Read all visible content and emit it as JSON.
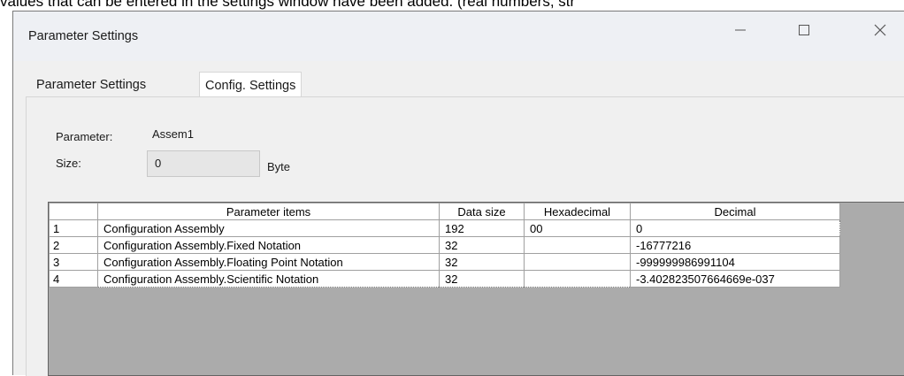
{
  "caption": "values that can be entered in the settings window have been added. (real numbers, str",
  "window": {
    "title": "Parameter Settings"
  },
  "tabs": [
    {
      "label": "Parameter Settings",
      "selected": false
    },
    {
      "label": "Config. Settings",
      "selected": true
    }
  ],
  "form": {
    "parameter_label": "Parameter:",
    "parameter_value": "Assem1",
    "size_label": "Size:",
    "size_value": "0",
    "size_unit": "Byte"
  },
  "table": {
    "headers": [
      "",
      "Parameter items",
      "Data size",
      "Hexadecimal",
      "Decimal"
    ],
    "rows": [
      {
        "num": "1",
        "item": "Configuration Assembly",
        "size": "192",
        "hex": "00",
        "dec": "0"
      },
      {
        "num": "2",
        "item": "Configuration Assembly.Fixed Notation",
        "size": "32",
        "hex": "",
        "dec": "-16777216"
      },
      {
        "num": "3",
        "item": "Configuration Assembly.Floating Point Notation",
        "size": "32",
        "hex": "",
        "dec": "-999999986991104"
      },
      {
        "num": "4",
        "item": "Configuration Assembly.Scientific Notation",
        "size": "32",
        "hex": "",
        "dec": "-3.402823507664669e-037"
      }
    ]
  },
  "icons": {
    "minimize": "minimize-icon",
    "maximize": "maximize-icon",
    "close": "close-icon"
  }
}
